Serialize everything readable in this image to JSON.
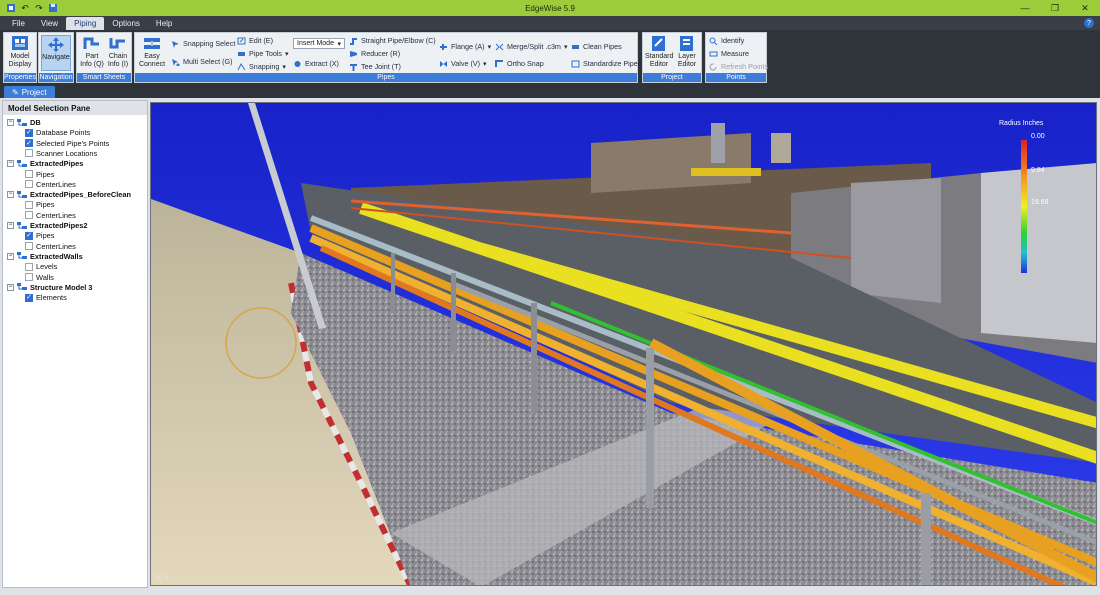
{
  "window": {
    "title": "EdgeWise 5.9"
  },
  "menu": {
    "items": [
      "File",
      "View",
      "Piping",
      "Options",
      "Help"
    ],
    "active": "Piping"
  },
  "ribbon": {
    "properties": {
      "label": "Properties",
      "model_display": "Model\nDisplay"
    },
    "navigation": {
      "label": "Navigation",
      "navigate": "Navigate"
    },
    "smart_sheets": {
      "label": "Smart Sheets",
      "part_info": "Part\nInfo (Q)",
      "chain_info": "Chain\nInfo (I)"
    },
    "pipes": {
      "label": "Pipes",
      "easy_connect": "Easy\nConnect",
      "snapping_select": "Snapping Select",
      "multi_select": "Multi Select (G)",
      "edit": "Edit (E)",
      "pipe_tools": "Pipe Tools",
      "snapping": "Snapping",
      "insert_mode": "Insert Mode",
      "extract": "Extract (X)",
      "straight_pipe": "Straight Pipe/Elbow (C)",
      "reducer": "Reducer (R)",
      "tee_joint": "Tee Joint (T)",
      "flange": "Flange (A)",
      "valve": "Valve (V)",
      "merge_split": "Merge/Split .c3m",
      "ortho_snap": "Ortho Snap",
      "clean_pipes": "Clean Pipes",
      "standardize_pipes": "Standardize Pipes"
    },
    "project": {
      "label": "Project",
      "standard_editor": "Standard\nEditor",
      "layer_editor": "Layer\nEditor"
    },
    "points": {
      "label": "Points",
      "identify": "Identify",
      "measure": "Measure",
      "refresh_points": "Refresh Points"
    }
  },
  "tabs": {
    "project": "Project"
  },
  "pane": {
    "title": "Model Selection Pane",
    "tree": [
      {
        "label": "DB",
        "children": [
          {
            "label": "Database Points",
            "checked": true
          },
          {
            "label": "Selected Pipe's Points",
            "checked": true
          },
          {
            "label": "Scanner Locations",
            "checked": false
          }
        ]
      },
      {
        "label": "ExtractedPipes",
        "children": [
          {
            "label": "Pipes",
            "checked": false
          },
          {
            "label": "CenterLines",
            "checked": false
          }
        ]
      },
      {
        "label": "ExtractedPipes_BeforeClean",
        "children": [
          {
            "label": "Pipes",
            "checked": false
          },
          {
            "label": "CenterLines",
            "checked": false
          }
        ]
      },
      {
        "label": "ExtractedPipes2",
        "children": [
          {
            "label": "Pipes",
            "checked": true
          },
          {
            "label": "CenterLines",
            "checked": false
          }
        ]
      },
      {
        "label": "ExtractedWalls",
        "children": [
          {
            "label": "Levels",
            "checked": false
          },
          {
            "label": "Walls",
            "checked": false
          }
        ]
      },
      {
        "label": "Structure Model 3",
        "children": [
          {
            "label": "Elements",
            "checked": true
          }
        ]
      }
    ]
  },
  "viewport": {
    "legend_title": "Radius Inches",
    "legend_ticks": [
      "0.00",
      "9.84",
      "19.69"
    ],
    "scale_text": "30 ft"
  },
  "colors": {
    "accent": "#3b7dd8",
    "titlebar": "#9ccc3a",
    "sky": "#1f2bd4"
  }
}
